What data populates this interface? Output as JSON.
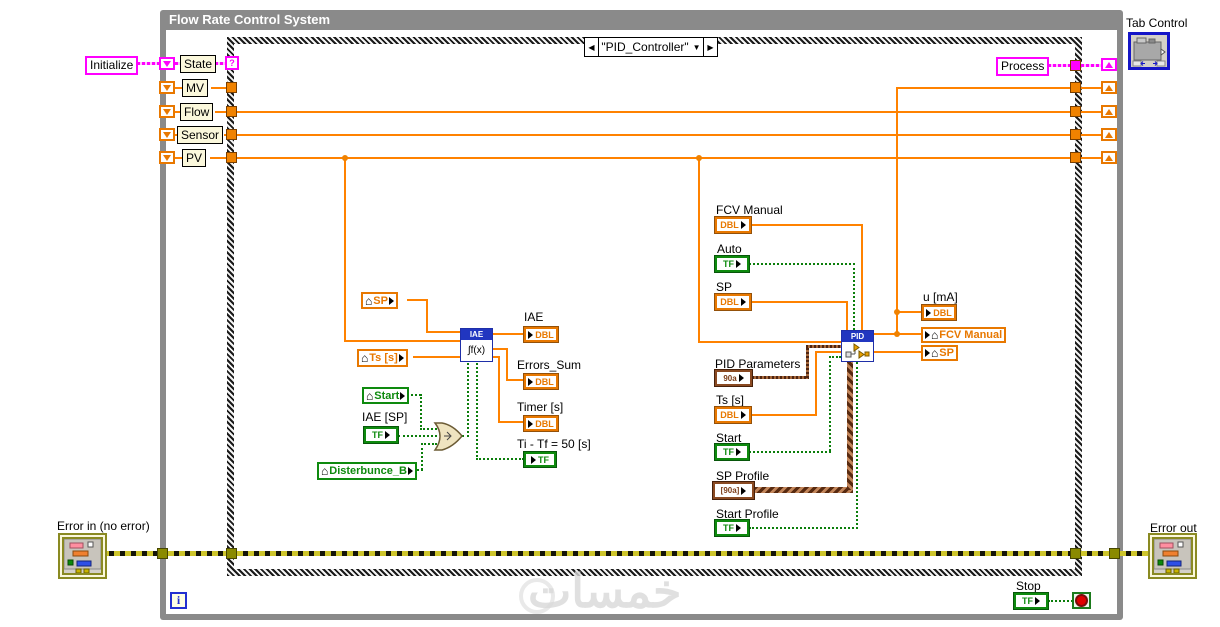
{
  "loop": {
    "title": "Flow Rate Control System",
    "iteration_label": "i"
  },
  "case_structure": {
    "selector": "\"PID_Controller\""
  },
  "left_io": {
    "initialize": "Initialize",
    "state": "State",
    "mv": "MV",
    "flow": "Flow",
    "sensor": "Sensor",
    "pv": "PV",
    "question_mark": "?"
  },
  "right_io": {
    "process": "Process"
  },
  "glyphs": {
    "dbl": "DBL",
    "tf": "TF",
    "cluster": "90a",
    "cluster_array": "[90a]",
    "integral": "∫f(x)",
    "house": "⌂"
  },
  "iae_section": {
    "sp_local": "SP",
    "ts_local": "Ts [s]",
    "start_local": "Start",
    "iae_sp_label": "IAE [SP]",
    "disturbance_local": "Disterbunce_B",
    "vi_title": "IAE",
    "out_iae": "IAE",
    "out_errors_sum": "Errors_Sum",
    "out_timer": "Timer [s]",
    "out_ti_tf": "Ti - Tf = 50 [s]"
  },
  "pid_section": {
    "vi_title": "PID",
    "fcv_manual": "FCV Manual",
    "auto": "Auto",
    "sp": "SP",
    "pid_parameters": "PID Parameters",
    "ts": "Ts [s]",
    "start": "Start",
    "sp_profile": "SP Profile",
    "start_profile": "Start Profile",
    "u_ma": "u [mA]",
    "fcv_manual_write": "FCV Manual",
    "sp_write": "SP"
  },
  "bottom": {
    "error_in": "Error in (no error)",
    "error_out": "Error out",
    "stop": "Stop"
  },
  "misc": {
    "tab_control": "Tab Control",
    "watermark": "خمسات"
  }
}
